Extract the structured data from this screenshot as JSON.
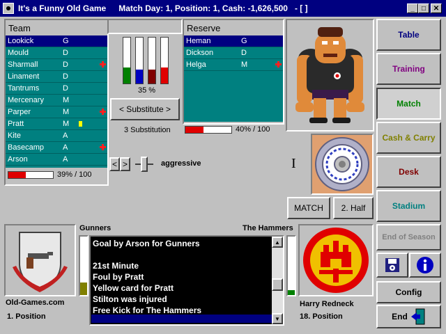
{
  "window": {
    "title": "It's a Funny Old Game",
    "status": "Match Day: 1, Position: 1, Cash: -1,626,500",
    "extra": "- [ ]"
  },
  "team": {
    "header": "Team",
    "players": [
      {
        "name": "Lookick",
        "pos": "G"
      },
      {
        "name": "Mould",
        "pos": "D"
      },
      {
        "name": "Sharmall",
        "pos": "D"
      },
      {
        "name": "Linament",
        "pos": "D"
      },
      {
        "name": "Tantrums",
        "pos": "D"
      },
      {
        "name": "Mercenary",
        "pos": "M"
      },
      {
        "name": "Parper",
        "pos": "M"
      },
      {
        "name": "Pratt",
        "pos": "M"
      },
      {
        "name": "Kite",
        "pos": "A"
      },
      {
        "name": "Basecamp",
        "pos": "A"
      },
      {
        "name": "Arson",
        "pos": "A"
      }
    ],
    "strength_label": "39% / 100",
    "strength_value": 39
  },
  "middle": {
    "meter_percent_label": "35 %",
    "meters": [
      {
        "color": "#008000",
        "level": 0.35
      },
      {
        "color": "#0000c0",
        "level": 0.3
      },
      {
        "color": "#800000",
        "level": 0.3
      },
      {
        "color": "#e00000",
        "level": 0.35
      }
    ],
    "substitute_button": "< Substitute >",
    "substitution_count": "3 Substitution",
    "tactic_label": "aggressive"
  },
  "reserve": {
    "header": "Reserve",
    "players": [
      {
        "name": "Heman",
        "pos": "G"
      },
      {
        "name": "Dickson",
        "pos": "D"
      },
      {
        "name": "Helga",
        "pos": "M"
      }
    ],
    "strength_label": "40% / 100",
    "strength_value": 40
  },
  "match_controls": {
    "match_button": "MATCH",
    "half_button": "2. Half",
    "cursor_glyph": "I"
  },
  "sidebar": {
    "items": [
      {
        "label": "Table",
        "color": "#000080"
      },
      {
        "label": "Training",
        "color": "#800080"
      },
      {
        "label": "Match",
        "color": "#008000"
      },
      {
        "label": "Cash & Carry",
        "color": "#808000"
      },
      {
        "label": "Desk",
        "color": "#800000"
      },
      {
        "label": "Stadium",
        "color": "#008080"
      },
      {
        "label": "End of Season",
        "color": "#808080"
      },
      {
        "label": "Config",
        "color": "#000000"
      },
      {
        "label": "End",
        "color": "#000000"
      }
    ]
  },
  "bottom": {
    "home_team": "Gunners",
    "away_team": "The Hammers",
    "home_club": "Old-Games.com",
    "home_position": "1. Position",
    "away_manager": "Harry Redneck",
    "away_position": "18. Position",
    "messages": [
      "Goal by Arson for Gunners",
      "",
      "21st Minute",
      "Foul by Pratt",
      "Yellow card for Pratt",
      "Stilton was injured",
      "Free Kick for The Hammers"
    ]
  }
}
